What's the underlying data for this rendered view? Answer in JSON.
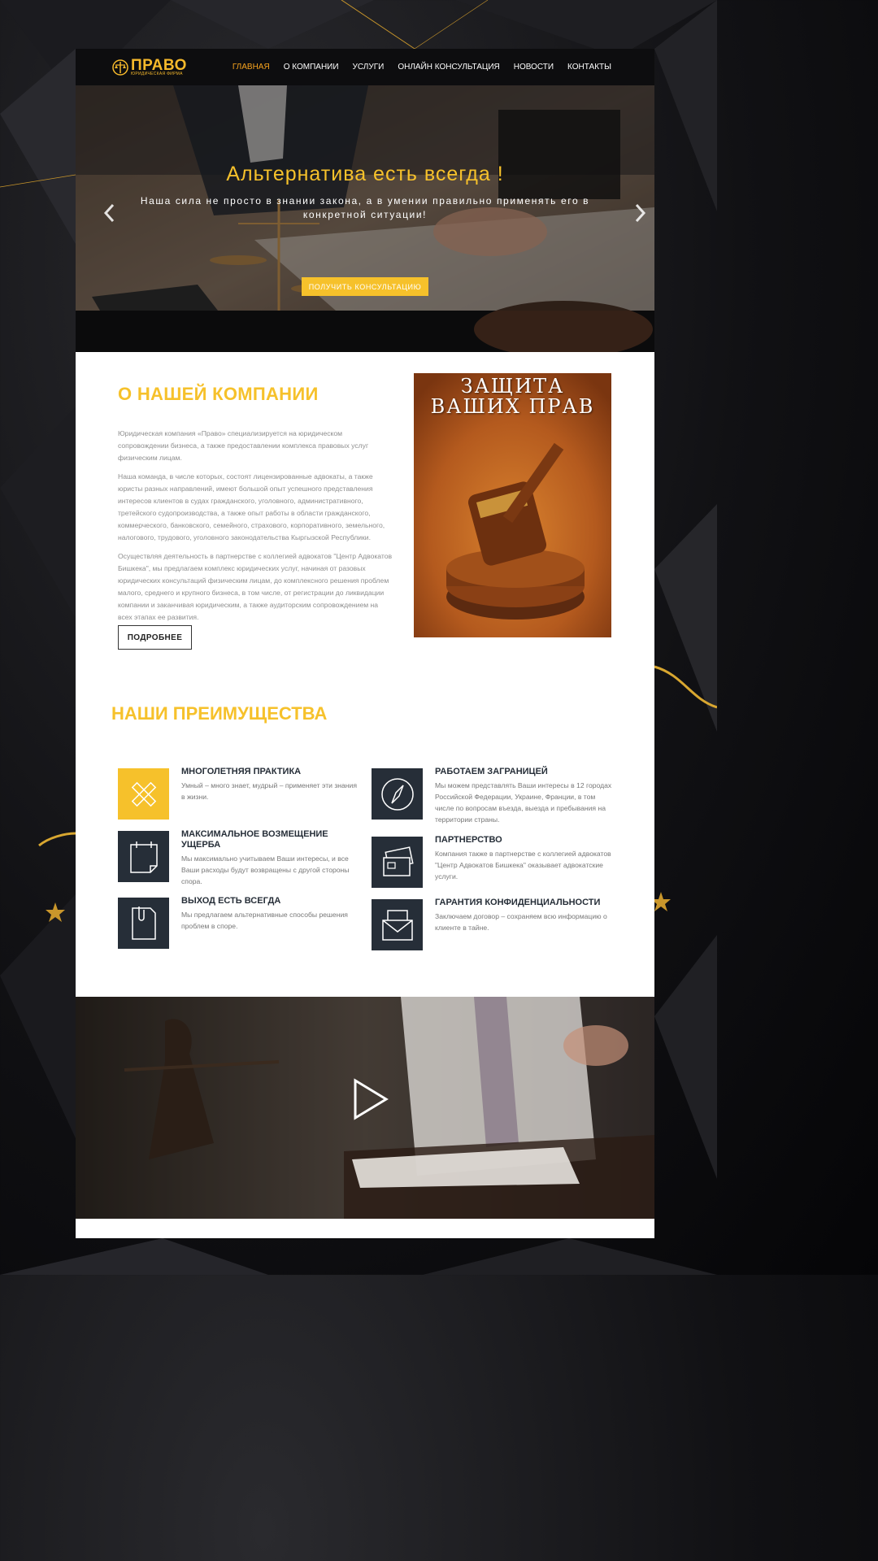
{
  "colors": {
    "accent": "#f6c12b",
    "nav_active": "#f6a31e",
    "dark": "#262e38",
    "text_muted": "#8e8e8e"
  },
  "logo": {
    "title": "ПРАВО",
    "subtitle": "ЮРИДИЧЕСКАЯ ФИРМА",
    "icon": "lady-justice-icon"
  },
  "nav": {
    "items": [
      {
        "label": "ГЛАВНАЯ",
        "active": true
      },
      {
        "label": "О КОМПАНИИ",
        "active": false
      },
      {
        "label": "УСЛУГИ",
        "active": false
      },
      {
        "label": "ОНЛАЙН КОНСУЛЬТАЦИЯ",
        "active": false
      },
      {
        "label": "НОВОСТИ",
        "active": false
      },
      {
        "label": "КОНТАКТЫ",
        "active": false
      }
    ]
  },
  "hero": {
    "title": "Альтернатива есть всегда !",
    "subtitle": "Наша сила не просто в знании закона, а в умении правильно применять его в конкретной ситуации!",
    "button": "ПОЛУЧИТЬ КОНСУЛЬТАЦИЮ",
    "prev_icon": "chevron-left-icon",
    "next_icon": "chevron-right-icon"
  },
  "about": {
    "title": "О НАШЕЙ КОМПАНИИ",
    "paragraphs": [
      "Юридическая компания «Право» специализируется на юридическом сопровождении бизнеса, а также предоставлении комплекса правовых услуг физическим лицам.",
      "Наша команда, в числе которых, состоят лицензированные адвокаты, а также юристы разных направлений, имеют большой опыт успешного представления интересов клиентов в судах гражданского, уголовного, административного, третейского судопроизводства, а также опыт работы в области гражданского, коммерческого, банковского, семейного, страхового, корпоративного, земельного, налогового, трудового, уголовного законодательства Кыргызской Республики.",
      "Осуществляя деятельность в партнерстве с коллегией адвокатов \"Центр Адвокатов Бишкека\", мы предлагаем комплекс юридических услуг, начиная от разовых юридических консультаций физическим лицам, до комплексного решения проблем малого, среднего и крупного бизнеса, в том числе, от регистрации до ликвидации компании и заканчивая юридическим, а также аудиторским сопровождением на всех этапах ее развития."
    ],
    "button": "ПОДРОБНЕЕ",
    "image_caption": "ЗАЩИТА ВАШИХ ПРАВ"
  },
  "advantages": {
    "title": "НАШИ ПРЕИМУЩЕСТВА",
    "items": [
      {
        "title": "МНОГОЛЕТНЯЯ ПРАКТИКА",
        "text": "Умный – много знает, мудрый – применяет эти знания в жизни.",
        "icon": "ruler-pencil-icon"
      },
      {
        "title": "РАБОТАЕМ ЗАГРАНИЦЕЙ",
        "text": "Мы можем представлять Ваши интересы в 12 городах Российской Федерации, Украине, Франции, в том числе по вопросам въезда, выезда и пребывания на территории страны.",
        "icon": "compass-icon"
      },
      {
        "title": "МАКСИМАЛЬНОЕ ВОЗМЕЩЕНИЕ УЩЕРБА",
        "text": "Мы максимально учитываем Ваши интересы, и все Ваши расходы будут возвращены с другой стороны спора.",
        "icon": "calendar-icon"
      },
      {
        "title": "ПАРТНЕРСТВО",
        "text": "Компания также в партнерстве с коллегией адвокатов \"Центр Адвокатов Бишкека\" оказывает адвокатские услуги.",
        "icon": "cards-icon"
      },
      {
        "title": "ВЫХОД ЕСТЬ ВСЕГДА",
        "text": "Мы предлагаем альтернативные способы решения проблем в споре.",
        "icon": "document-clip-icon"
      },
      {
        "title": "ГАРАНТИЯ КОНФИДЕНЦИАЛЬНОСТИ",
        "text": "Заключаем договор – сохраняем всю информацию о клиенте в тайне.",
        "icon": "envelope-icon"
      }
    ]
  },
  "video": {
    "play_icon": "play-icon"
  }
}
